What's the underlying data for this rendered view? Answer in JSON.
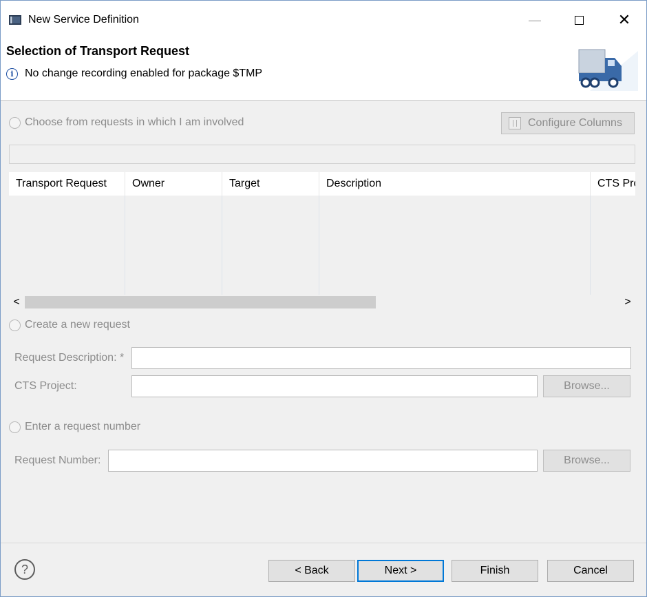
{
  "window": {
    "title": "New Service Definition",
    "minimize_label": "—",
    "close_label": "✕"
  },
  "header": {
    "title": "Selection of Transport Request",
    "info_icon": "i",
    "info_text": "No change recording enabled for package $TMP"
  },
  "involved": {
    "radio_label": "Choose from requests in which I am involved",
    "configure_columns_label": "Configure Columns",
    "columns": [
      "Transport Request",
      "Owner",
      "Target",
      "Description",
      "CTS Pro"
    ]
  },
  "scroll": {
    "left": "<",
    "right": ">"
  },
  "new_request": {
    "radio_label": "Create a new request",
    "description_label": "Request Description: *",
    "description_value": "",
    "cts_label": "CTS Project:",
    "cts_value": "",
    "browse_label": "Browse..."
  },
  "enter_request": {
    "radio_label": "Enter a request number",
    "number_label": "Request Number:",
    "number_value": "",
    "browse_label": "Browse..."
  },
  "footer": {
    "help_icon": "?",
    "back_label": "< Back",
    "next_label": "Next >",
    "finish_label": "Finish",
    "cancel_label": "Cancel"
  }
}
